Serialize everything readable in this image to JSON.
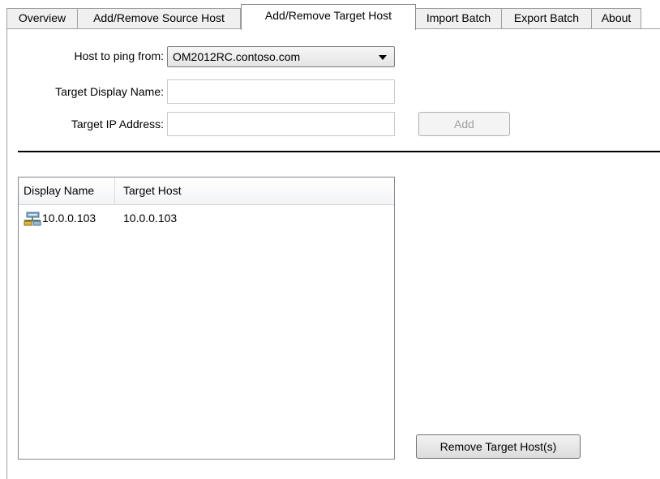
{
  "tabs": [
    {
      "label": "Overview",
      "active": false
    },
    {
      "label": "Add/Remove Source Host",
      "active": false
    },
    {
      "label": "Add/Remove Target Host",
      "active": true
    },
    {
      "label": "Import Batch",
      "active": false
    },
    {
      "label": "Export Batch",
      "active": false
    },
    {
      "label": "About",
      "active": false
    }
  ],
  "form": {
    "host_label": "Host to ping from:",
    "host_value": "OM2012RC.contoso.com",
    "display_name_label": "Target Display Name:",
    "display_name_value": "",
    "ip_label": "Target IP Address:",
    "ip_value": "",
    "add_button": "Add",
    "add_button_enabled": false
  },
  "list": {
    "columns": [
      "Display Name",
      "Target Host"
    ],
    "rows": [
      {
        "display_name": "10.0.0.103",
        "target_host": "10.0.0.103",
        "icon": "network-computer-icon"
      }
    ]
  },
  "remove_button": "Remove Target Host(s)",
  "colors": {
    "tab_background": "#f0f0f0",
    "active_tab_background": "#ffffff",
    "border": "#a0a0a0",
    "disabled_text": "#a0a0a0"
  }
}
